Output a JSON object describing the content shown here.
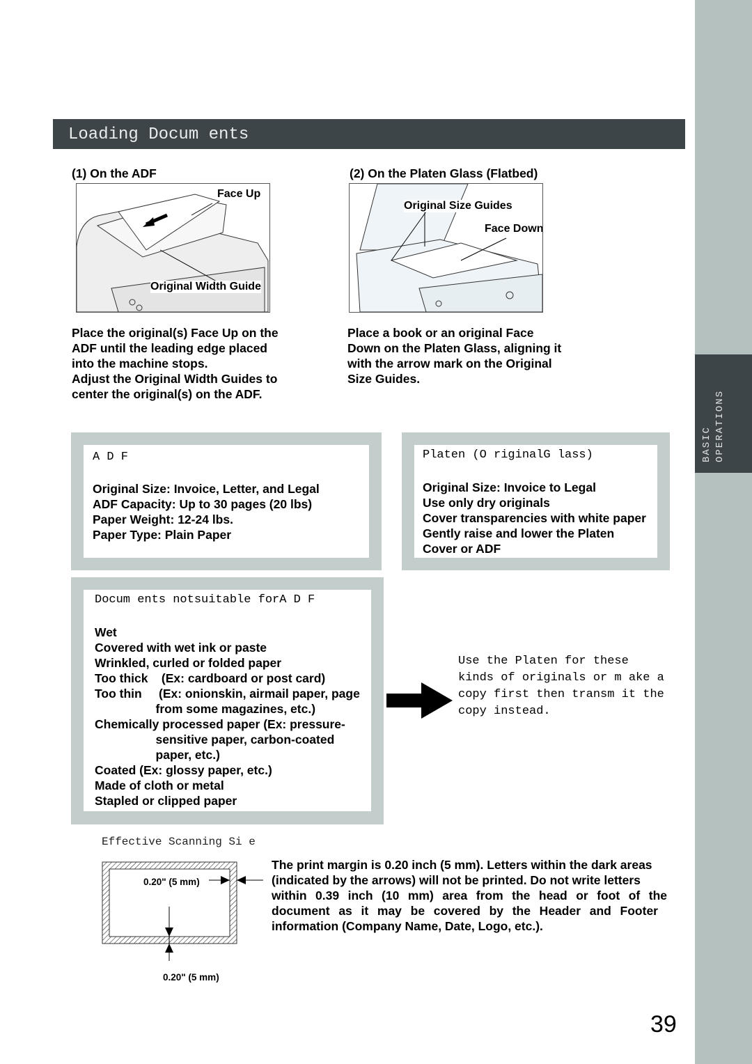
{
  "side_tab": {
    "line1": "BASIC",
    "line2": "OPERATIONS",
    "colors": {
      "sidebar": "#b4c1bf",
      "tab": "#3d4548"
    }
  },
  "header": {
    "title": "Loading Docum ents"
  },
  "adf_section": {
    "heading": "(1) On the ADF",
    "labels": {
      "face_up": "Face Up",
      "width_guide": "Original Width Guide"
    },
    "text": [
      "Place the original(s) Face Up on the",
      "ADF until the leading edge placed",
      "into the machine stops.",
      "Adjust the Original Width Guides to",
      "center the original(s) on the ADF."
    ]
  },
  "platen_section": {
    "heading": "(2) On the Platen Glass (Flatbed)",
    "labels": {
      "size_guides": "Original Size Guides",
      "face_down": "Face Down"
    },
    "text": [
      "Place a book or an original Face",
      "Down on the Platen Glass, aligning it",
      "with the arrow mark on the Original",
      "Size Guides."
    ]
  },
  "adf_box": {
    "title": "A D F",
    "lines": [
      "Original Size: Invoice, Letter, and Legal",
      "ADF Capacity: Up to 30 pages (20 lbs)",
      "Paper Weight: 12-24 lbs.",
      "Paper Type: Plain Paper"
    ]
  },
  "platen_box": {
    "title": "Platen (O riginalG lass)",
    "lines": [
      "Original Size: Invoice to Legal",
      "Use only dry originals",
      "Cover transparencies with white paper",
      "Gently raise and lower the Platen",
      "Cover or ADF"
    ]
  },
  "unsuitable_box": {
    "title": "Docum ents notsuitable forA D F",
    "lines": [
      "Wet",
      "Covered with wet ink or paste",
      "Wrinkled, curled or folded paper",
      "Too thick    (Ex: cardboard or post card)",
      "Too thin     (Ex: onionskin, airmail paper, page",
      "                  from some magazines, etc.)",
      "Chemically processed paper (Ex: pressure-",
      "                  sensitive paper, carbon-coated",
      "                  paper, etc.)",
      "Coated (Ex: glossy paper, etc.)",
      "Made of cloth or metal",
      "Stapled or clipped paper"
    ]
  },
  "platen_note": {
    "lines": [
      "Use  the  Platen  for  these",
      "kinds of originals or m ake a",
      "copy  first then  transm it the",
      "copy instead."
    ]
  },
  "scanning": {
    "title": "Effective Scanning Si e",
    "side_margin": "0.20\" (5 mm)",
    "bottom_margin": "0.20\" (5 mm)",
    "text": [
      "The print margin is 0.20 inch (5 mm). Letters within the dark areas",
      "(indicated by the arrows) will not be printed. Do not write letters",
      "within 0.39 inch (10 mm) area from the head or foot of the",
      "document as it may be covered by the Header and Footer",
      "information (Company Name, Date, Logo, etc.)."
    ]
  },
  "page_number": "39"
}
